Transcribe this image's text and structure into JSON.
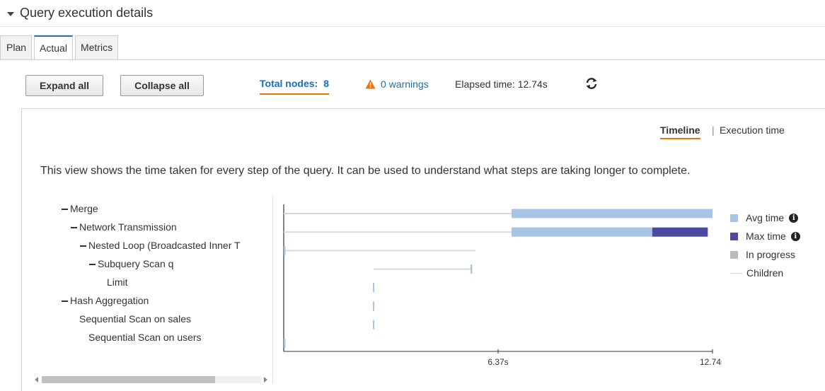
{
  "section": {
    "title": "Query execution details"
  },
  "tabs": [
    {
      "label": "Plan",
      "active": false
    },
    {
      "label": "Actual",
      "active": true
    },
    {
      "label": "Metrics",
      "active": false
    }
  ],
  "toolbar": {
    "expand_all": "Expand all",
    "collapse_all": "Collapse all",
    "total_nodes_label": "Total nodes:",
    "total_nodes_value": "8",
    "warnings": "0 warnings",
    "elapsed": "Elapsed time: 12.74s"
  },
  "view_toggle": {
    "timeline": "Timeline",
    "separator": "|",
    "execution_time": "Execution time"
  },
  "description": "This view shows the time taken for every step of the query. It can be used to understand what steps are taking longer to complete.",
  "tree": [
    {
      "label": "Merge",
      "depth": 0,
      "collapsible": true
    },
    {
      "label": "Network Transmission",
      "depth": 1,
      "collapsible": true
    },
    {
      "label": "Nested Loop (Broadcasted Inner T",
      "depth": 2,
      "collapsible": true
    },
    {
      "label": "Subquery Scan q",
      "depth": 3,
      "collapsible": true
    },
    {
      "label": "Limit",
      "depth": 4,
      "collapsible": false
    },
    {
      "label": "Hash Aggregation",
      "depth": 0,
      "collapsible": true
    },
    {
      "label": "Sequential Scan on sales",
      "depth": 1,
      "collapsible": false
    },
    {
      "label": "Sequential Scan on users",
      "depth": 2,
      "collapsible": false
    }
  ],
  "legend": [
    {
      "label": "Avg time",
      "color": "#a7c4e5",
      "info": true
    },
    {
      "label": "Max time",
      "color": "#4c4c9e",
      "info": true
    },
    {
      "label": "In progress",
      "color": "#bbbbbb",
      "info": false
    },
    {
      "label": "Children",
      "color": "#d9d9d9",
      "info": false,
      "line": true
    }
  ],
  "colors": {
    "accent": "#ec7211",
    "link": "#1a6fb5",
    "warning": "#ec7211"
  },
  "chart_data": {
    "type": "bar",
    "x_ticks": [
      "6.37s",
      "12.74s"
    ],
    "xlim": [
      0,
      12.74
    ],
    "rows": [
      {
        "name": "Merge",
        "children": [
          0,
          12.74
        ],
        "avg": [
          6.77,
          12.74
        ],
        "max": null
      },
      {
        "name": "Network Transmission",
        "children": [
          0,
          12.6
        ],
        "avg": [
          6.77,
          10.95
        ],
        "max": [
          10.95,
          12.6
        ]
      },
      {
        "name": "Nested Loop (Broadcasted Inner T",
        "children": [
          0,
          5.7
        ],
        "avg": [
          0,
          0.05
        ],
        "max": null
      },
      {
        "name": "Subquery Scan q",
        "children": [
          2.67,
          5.6
        ],
        "avg": [
          5.55,
          5.6
        ],
        "max": null
      },
      {
        "name": "Limit",
        "children": null,
        "avg": [
          2.65,
          2.69
        ],
        "max": null
      },
      {
        "name": "Hash Aggregation",
        "children": null,
        "avg": [
          2.65,
          2.69
        ],
        "max": null
      },
      {
        "name": "Sequential Scan on sales",
        "children": null,
        "avg": [
          2.65,
          2.69
        ],
        "max": null
      },
      {
        "name": "Sequential Scan on users",
        "children": null,
        "avg": [
          0,
          0.05
        ],
        "max": null
      }
    ]
  }
}
